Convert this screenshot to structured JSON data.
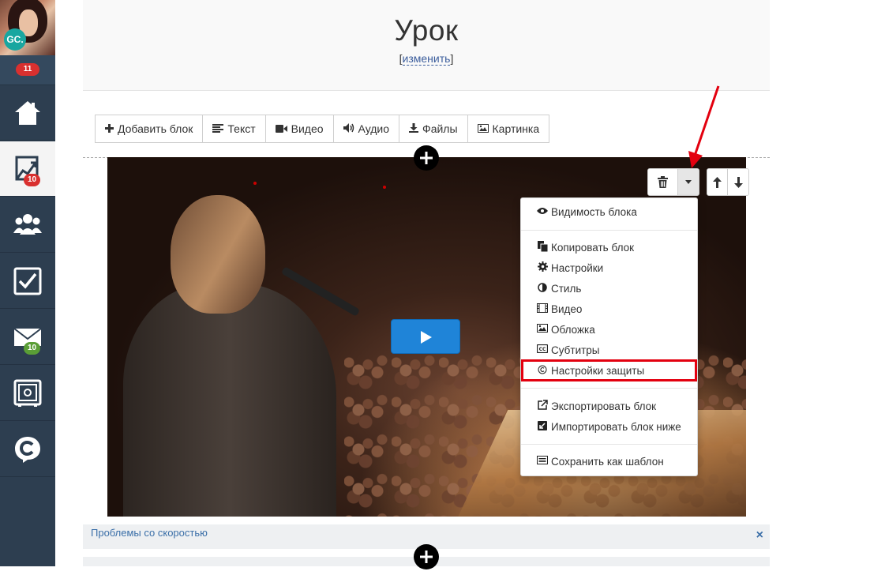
{
  "sidebar": {
    "avatar_initials": "GC.",
    "notifications_count": "11",
    "items": [
      {
        "name": "home",
        "icon": "home-icon",
        "badge": ""
      },
      {
        "name": "trainings",
        "icon": "chart-icon",
        "badge": "10"
      },
      {
        "name": "users",
        "icon": "users-icon",
        "badge": ""
      },
      {
        "name": "tasks",
        "icon": "checkbox-icon",
        "badge": ""
      },
      {
        "name": "messages",
        "icon": "mail-icon",
        "badge": "10"
      },
      {
        "name": "safe",
        "icon": "safe-icon",
        "badge": ""
      },
      {
        "name": "brand",
        "icon": "getcourse-logo-icon",
        "badge": ""
      }
    ]
  },
  "header": {
    "title": "Урок",
    "edit_link": "изменить"
  },
  "toolbar": {
    "add_block": "Добавить блок",
    "text": "Текст",
    "video": "Видео",
    "audio": "Аудио",
    "files": "Файлы",
    "image": "Картинка"
  },
  "dropdown": {
    "visibility": "Видимость блока",
    "copy": "Копировать блок",
    "settings": "Настройки",
    "style": "Стиль",
    "video": "Видео",
    "cover": "Обложка",
    "subtitles": "Субтитры",
    "protection": "Настройки защиты",
    "export": "Экспортировать блок",
    "import": "Импортировать блок ниже",
    "save_template": "Сохранить как шаблон"
  },
  "speed_bar": {
    "label": "Проблемы со скоростью",
    "close": "×"
  },
  "colors": {
    "sidebar_bg": "#2d3e50",
    "accent_blue": "#1f84d8",
    "highlight_red": "#e3000f",
    "badge_red": "#d9302f",
    "badge_green": "#5a9e36"
  }
}
